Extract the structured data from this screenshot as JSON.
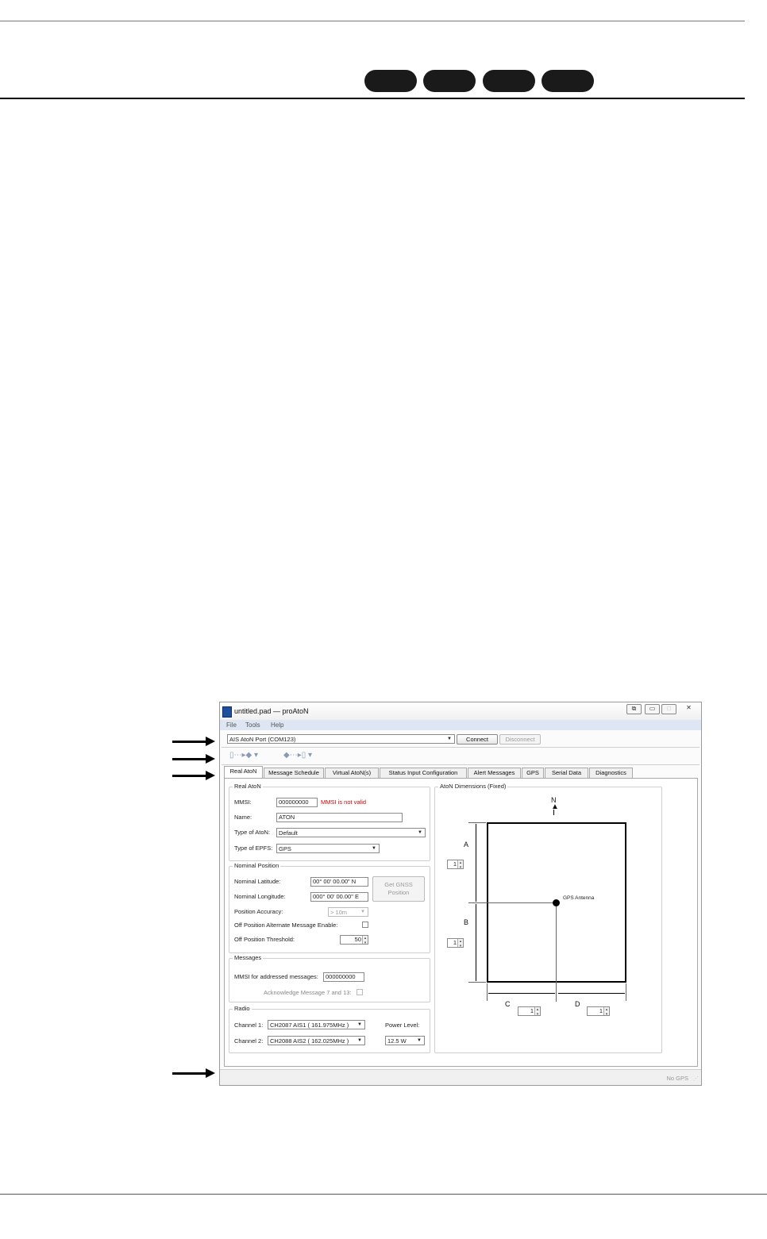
{
  "window": {
    "title": "untitled.pad — proAtoN",
    "menu": [
      "File",
      "Tools",
      "Help"
    ],
    "port_select": "AIS AtoN Port (COM123)",
    "connect_label": "Connect",
    "disconnect_label": "Disconnect",
    "tabs": [
      "Real AtoN",
      "Message Schedule",
      "Virtual AtoN(s)",
      "Status Input Configuration",
      "Alert Messages",
      "GPS",
      "Serial Data",
      "Diagnostics"
    ],
    "active_tab": "Real AtoN",
    "status_text": "No GPS"
  },
  "real_aton": {
    "group_label": "Real AtoN",
    "mmsi_label": "MMSI:",
    "mmsi_value": "000000000",
    "mmsi_error": "MMSI is not valid",
    "name_label": "Name:",
    "name_value": "ATON",
    "type_label": "Type of AtoN:",
    "type_value": "Default",
    "epfs_label": "Type of EPFS:",
    "epfs_value": "GPS"
  },
  "nominal_position": {
    "group_label": "Nominal Position",
    "lat_label": "Nominal Latitude:",
    "lat_value": "00° 00' 00.00\" N",
    "lon_label": "Nominal Longitude:",
    "lon_value": "000° 00' 00.00\" E",
    "gnss_button": "Get GNSS Position",
    "accuracy_label": "Position Accuracy:",
    "accuracy_value": "> 10m",
    "offpos_enable_label": "Off Position Alternate Message Enable:",
    "offpos_threshold_label": "Off Position Threshold:",
    "offpos_threshold_value": "50"
  },
  "messages": {
    "group_label": "Messages",
    "mmsi_addr_label": "MMSI for addressed messages:",
    "mmsi_addr_value": "000000000",
    "ack_label": "Acknowledge Message 7 and 13:"
  },
  "radio": {
    "group_label": "Radio",
    "ch1_label": "Channel 1:",
    "ch1_value": "CH2087 AIS1 ( 161.975MHz )",
    "ch2_label": "Channel 2:",
    "ch2_value": "CH2088 AIS2 ( 162.025MHz )",
    "power_label": "Power Level:",
    "power_value": "12.5 W"
  },
  "dimensions": {
    "group_label": "AtoN Dimensions (Fixed)",
    "north": "N",
    "antenna": "GPS Antenna",
    "a_label": "A",
    "a_value": "1",
    "b_label": "B",
    "b_value": "1",
    "c_label": "C",
    "c_value": "1",
    "d_label": "D",
    "d_value": "1"
  }
}
